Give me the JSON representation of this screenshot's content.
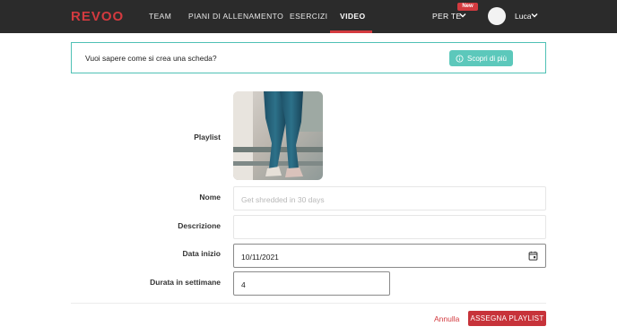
{
  "brand": {
    "logo": "REVOO",
    "accent": "#d33a3f",
    "nav_bg": "#2b2b2b",
    "teal": "#4fc1b5"
  },
  "nav": {
    "items": [
      {
        "label": "TEAM"
      },
      {
        "label": "PIANI DI ALLENAMENTO"
      },
      {
        "label": "ESERCIZI"
      },
      {
        "label": "VIDEO",
        "active": true
      }
    ],
    "per_te": "PER TE",
    "new_badge": "New",
    "user": "Luca"
  },
  "banner": {
    "text": "Vuoi sapere come si crea una scheda?",
    "button": "Scopri di più",
    "button_icon": "info-icon"
  },
  "form": {
    "playlist_label": "Playlist",
    "nome_label": "Nome",
    "nome_placeholder": "Get shredded in 30 days",
    "descrizione_label": "Descrizione",
    "data_inizio_label": "Data inizio",
    "data_inizio_value": "10/11/2021",
    "durata_label": "Durata in settimane",
    "durata_value": "4"
  },
  "actions": {
    "cancel": "Annulla",
    "assign": "ASSEGNA PLAYLIST"
  }
}
